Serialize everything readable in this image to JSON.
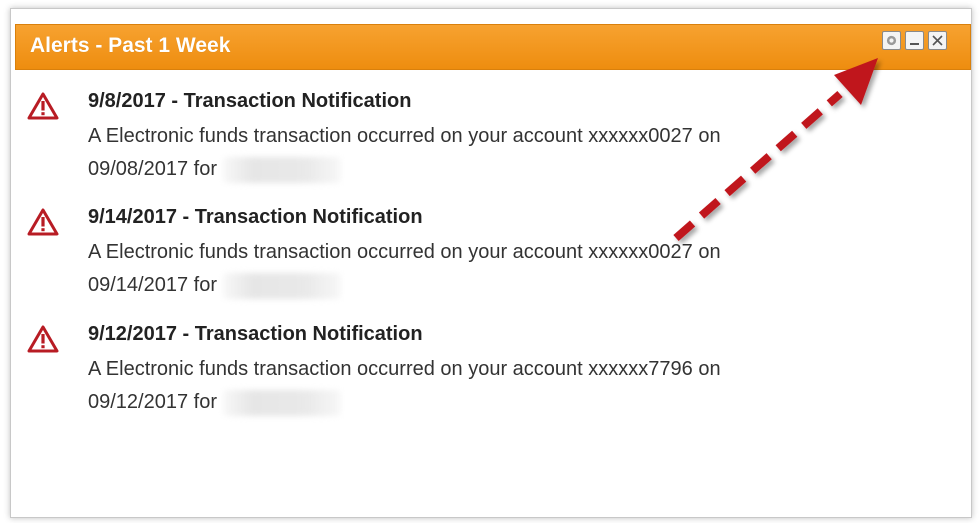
{
  "widget": {
    "title": "Alerts - Past 1 Week",
    "header_color": "#F29417",
    "controls": [
      {
        "name": "settings",
        "icon": "gear-icon"
      },
      {
        "name": "minimize",
        "icon": "minimize-icon"
      },
      {
        "name": "close",
        "icon": "close-icon"
      }
    ]
  },
  "alerts": [
    {
      "icon": "warning-icon",
      "title": "9/8/2017 - Transaction Notification",
      "line1": "A Electronic funds transaction occurred on your account xxxxxx0027 on",
      "line2": "09/08/2017 for"
    },
    {
      "icon": "warning-icon",
      "title": "9/14/2017 - Transaction Notification",
      "line1": "A Electronic funds transaction occurred on your account xxxxxx0027 on",
      "line2": "09/14/2017 for"
    },
    {
      "icon": "warning-icon",
      "title": "9/12/2017 - Transaction Notification",
      "line1": "A Electronic funds transaction occurred on your account xxxxxx7796 on",
      "line2": "09/12/2017 for"
    }
  ],
  "annotation": {
    "icon": "dashed-arrow",
    "color": "#C0141C",
    "points_to": "settings"
  }
}
